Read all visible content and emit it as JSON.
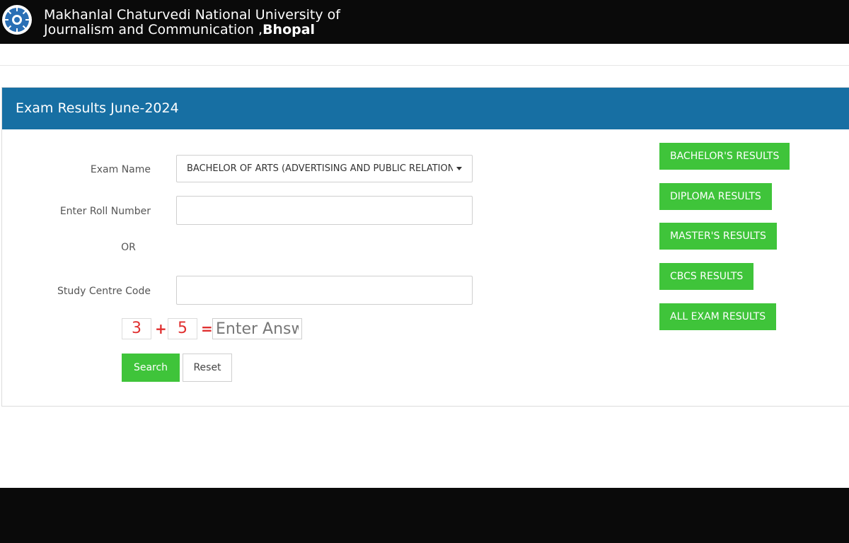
{
  "header": {
    "title_line1": "Makhanlal Chaturvedi National University of",
    "title_line2_prefix": "Journalism and Communication ,",
    "title_line2_bold": "Bhopal"
  },
  "panel": {
    "title": "Exam Results June-2024"
  },
  "form": {
    "exam_name_label": "Exam Name",
    "exam_name_selected": "BACHELOR OF ARTS (ADVERTISING AND PUBLIC RELATIONS)",
    "roll_label": "Enter Roll Number",
    "roll_value": "",
    "or_text": "OR",
    "study_centre_label": "Study Centre Code",
    "study_centre_value": "",
    "captcha": {
      "num1": "3",
      "op": "+",
      "num2": "5",
      "eq": "=",
      "placeholder": "Enter Answer"
    },
    "search_label": "Search",
    "reset_label": "Reset"
  },
  "side_links": [
    {
      "label": "BACHELOR'S RESULTS"
    },
    {
      "label": "DIPLOMA RESULTS"
    },
    {
      "label": "MASTER'S RESULTS"
    },
    {
      "label": "CBCS RESULTS"
    },
    {
      "label": "ALL EXAM RESULTS"
    }
  ],
  "colors": {
    "header_bg": "#0a0a0a",
    "panel_heading_bg": "#176fa3",
    "accent_green": "#3fc43a",
    "captcha_red": "#e03030"
  },
  "icons": {
    "logo": "university-emblem-icon",
    "dropdown": "caret-down-icon"
  }
}
